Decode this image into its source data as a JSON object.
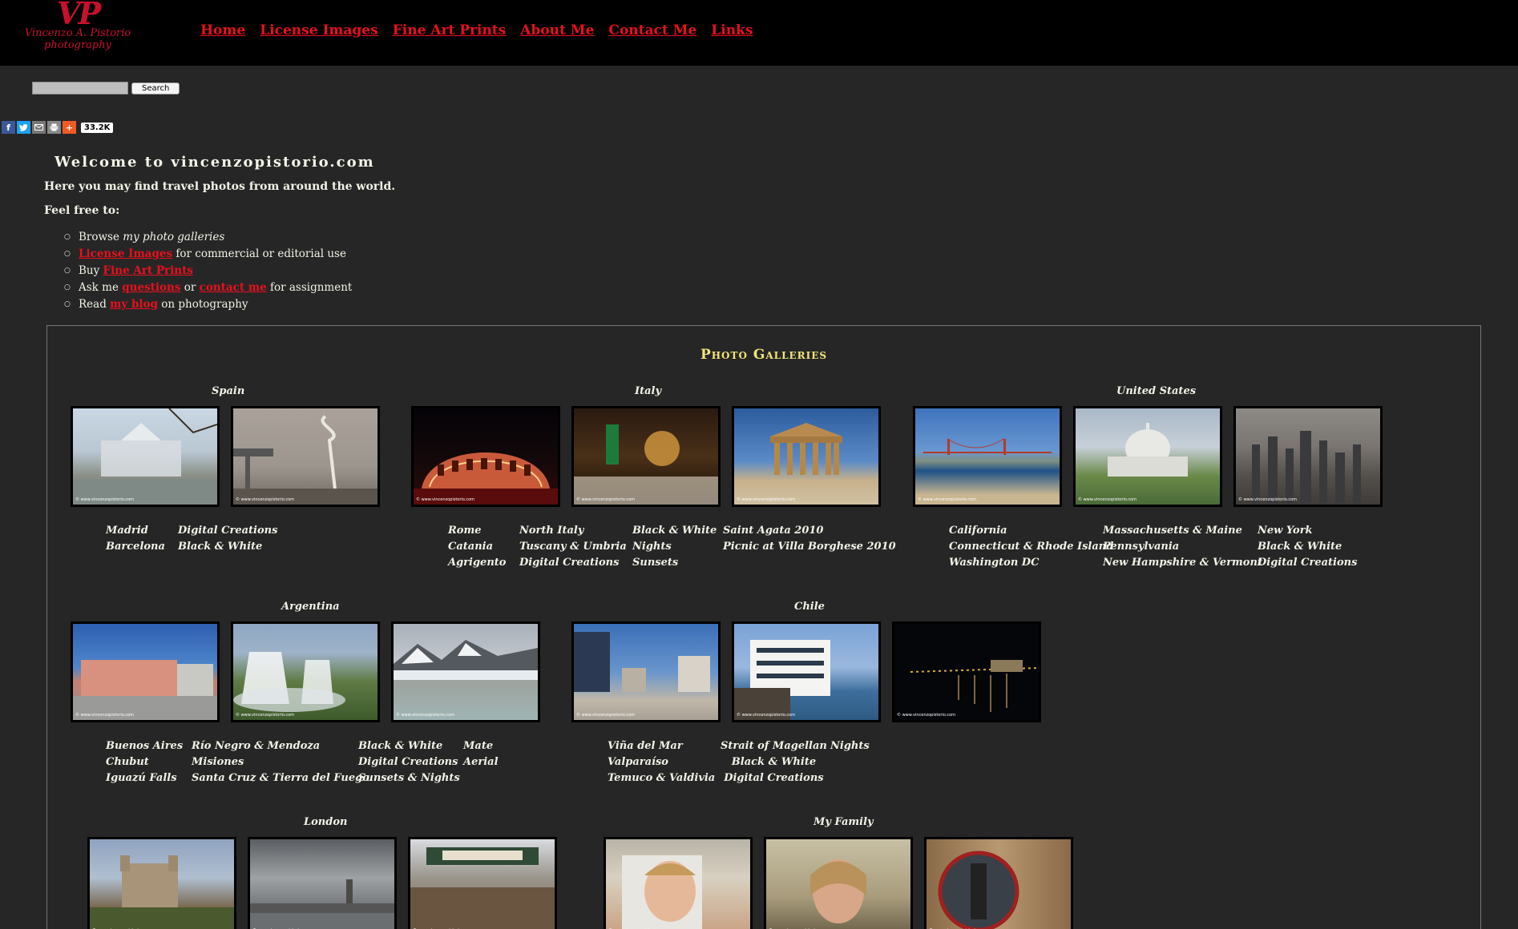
{
  "logo": {
    "mark": "VP",
    "name": "Vincenzo A. Pistorio",
    "sub": "photography"
  },
  "nav": [
    {
      "label": "Home"
    },
    {
      "label": "License Images"
    },
    {
      "label": "Fine Art Prints"
    },
    {
      "label": "About Me"
    },
    {
      "label": "Contact Me"
    },
    {
      "label": "Links"
    }
  ],
  "search": {
    "button": "Search",
    "value": ""
  },
  "share": {
    "count": "33.2K"
  },
  "welcome": "Welcome to vincenzopistorio.com",
  "intro": "Here you may find travel photos from around the world.",
  "feel_free": "Feel free to:",
  "todo": {
    "browse_pre": "Browse ",
    "browse_em": "my photo galleries",
    "license_link": "License Images",
    "license_post": " for commercial or editorial use",
    "buy_pre": "Buy ",
    "buy_link": "Fine Art Prints",
    "ask_pre": "Ask me ",
    "ask_link1": "questions",
    "ask_mid": " or ",
    "ask_link2": "contact me",
    "ask_post": " for assignment",
    "read_pre": "Read ",
    "read_link": "my blog",
    "read_post": " on photography"
  },
  "galleries_title": "Photo Galleries",
  "watermark": "© www.vincenzopistorio.com",
  "regions": {
    "spain": {
      "title": "Spain",
      "col1": [
        "Madrid",
        "Barcelona"
      ],
      "col2": [
        "Digital Creations",
        "Black & White"
      ]
    },
    "italy": {
      "title": "Italy",
      "col1": [
        "Rome",
        "Catania",
        "Agrigento"
      ],
      "col2": [
        "North Italy",
        "Tuscany & Umbria",
        "Digital Creations"
      ],
      "col3": [
        "Black & White",
        "Nights",
        "Sunsets"
      ],
      "col4": [
        "Saint Agata 2010",
        "Picnic at Villa Borghese 2010"
      ]
    },
    "us": {
      "title": "United States",
      "col1": [
        "California",
        "Connecticut & Rhode Island",
        "Washington DC"
      ],
      "col2": [
        "Massachusetts & Maine",
        "Pennsylvania",
        "New Hampshire & Vermont"
      ],
      "col3": [
        "New York",
        "Black & White",
        "Digital Creations"
      ]
    },
    "argentina": {
      "title": "Argentina",
      "col1": [
        "Buenos Aires",
        "Chubut",
        "Iguazú Falls"
      ],
      "col2": [
        "Río Negro & Mendoza",
        "Misiones",
        "Santa Cruz & Tierra del Fuego"
      ],
      "col3": [
        "Black & White",
        "Digital Creations",
        "Sunsets & Nights"
      ],
      "col4": [
        "Mate",
        "Aerial"
      ]
    },
    "chile": {
      "title": "Chile",
      "col1": [
        "Viña del Mar",
        "Valparaíso",
        "Temuco & Valdivia"
      ],
      "col2": [
        "Strait of Magellan",
        "Black & White",
        "Digital Creations"
      ],
      "col3": [
        "Nights"
      ]
    },
    "london": {
      "title": "London"
    },
    "family": {
      "title": "My Family"
    }
  },
  "colors": {
    "accent": "#e8101e",
    "title": "#f2e67a",
    "background": "#262626"
  }
}
